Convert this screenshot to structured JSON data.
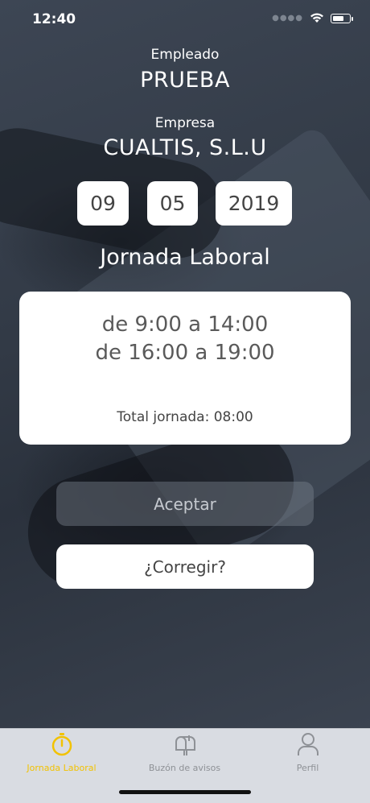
{
  "status_bar": {
    "time": "12:40"
  },
  "employee": {
    "label": "Empleado",
    "name": "PRUEBA"
  },
  "company": {
    "label": "Empresa",
    "name": "CUALTIS, S.L.U"
  },
  "date": {
    "day": "09",
    "month": "05",
    "year": "2019"
  },
  "workday": {
    "title": "Jornada Laboral",
    "shift_1": "de 9:00 a 14:00",
    "shift_2": "de 16:00 a 19:00",
    "total": "Total jornada: 08:00"
  },
  "actions": {
    "accept_label": "Aceptar",
    "correct_label": "¿Corregir?"
  },
  "tabbar": {
    "items": [
      {
        "label": "Jornada Laboral",
        "icon": "stopwatch-icon",
        "active": true
      },
      {
        "label": "Buzón de avisos",
        "icon": "mailbox-icon",
        "active": false
      },
      {
        "label": "Perfil",
        "icon": "person-icon",
        "active": false
      }
    ],
    "active_color": "#f2c200"
  }
}
